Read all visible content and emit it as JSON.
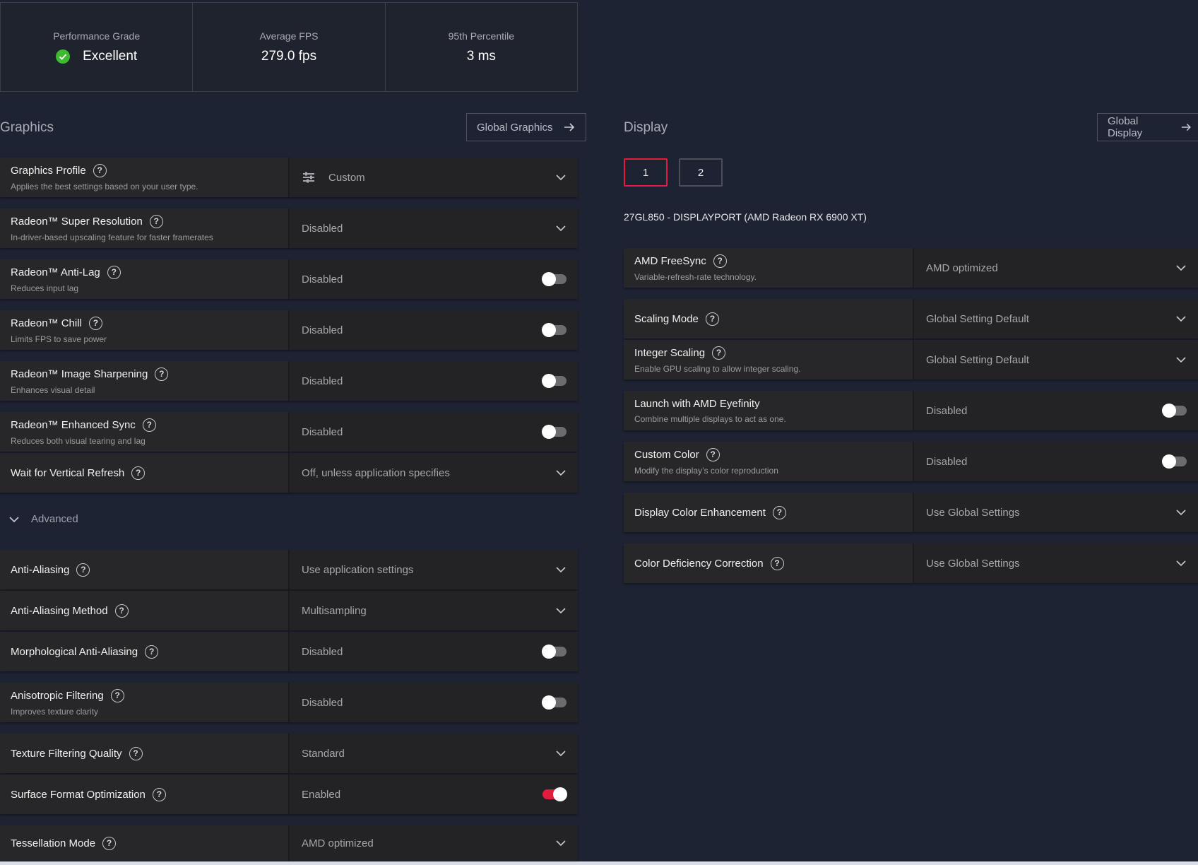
{
  "stats": [
    {
      "label": "Performance Grade",
      "value": "Excellent"
    },
    {
      "label": "Average FPS",
      "value": "279.0 fps"
    },
    {
      "label": "95th Percentile",
      "value": "3 ms"
    }
  ],
  "graphics": {
    "title": "Graphics",
    "global_button": "Global Graphics",
    "rows": [
      {
        "title": "Graphics Profile",
        "desc": "Applies the best settings based on your user type.",
        "value": "Custom",
        "control": "dropdown"
      },
      {
        "title": "Radeon™ Super Resolution",
        "desc": "In-driver-based upscaling feature for faster framerates",
        "value": "Disabled",
        "control": "dropdown"
      },
      {
        "title": "Radeon™ Anti-Lag",
        "desc": "Reduces input lag",
        "value": "Disabled",
        "control": "toggle"
      },
      {
        "title": "Radeon™ Chill",
        "desc": "Limits FPS to save power",
        "value": "Disabled",
        "control": "toggle"
      },
      {
        "title": "Radeon™ Image Sharpening",
        "desc": "Enhances visual detail",
        "value": "Disabled",
        "control": "toggle"
      },
      {
        "title": "Radeon™ Enhanced Sync",
        "desc": "Reduces both visual tearing and lag",
        "value": "Disabled",
        "control": "toggle"
      },
      {
        "title": "Wait for Vertical Refresh",
        "desc": "",
        "value": "Off, unless application specifies",
        "control": "dropdown"
      }
    ],
    "advanced_label": "Advanced",
    "advanced_rows": [
      {
        "title": "Anti-Aliasing",
        "desc": "",
        "value": "Use application settings",
        "control": "dropdown"
      },
      {
        "title": "Anti-Aliasing Method",
        "desc": "",
        "value": "Multisampling",
        "control": "dropdown"
      },
      {
        "title": "Morphological Anti-Aliasing",
        "desc": "",
        "value": "Disabled",
        "control": "toggle"
      },
      {
        "title": "Anisotropic Filtering",
        "desc": "Improves texture clarity",
        "value": "Disabled",
        "control": "toggle"
      },
      {
        "title": "Texture Filtering Quality",
        "desc": "",
        "value": "Standard",
        "control": "dropdown"
      },
      {
        "title": "Surface Format Optimization",
        "desc": "",
        "value": "Enabled",
        "control": "toggle-on"
      },
      {
        "title": "Tessellation Mode",
        "desc": "",
        "value": "AMD optimized",
        "control": "dropdown"
      }
    ]
  },
  "display": {
    "title": "Display",
    "global_button": "Global Display",
    "tabs": [
      "1",
      "2"
    ],
    "monitor": "27GL850 - DISPLAYPORT (AMD Radeon RX 6900 XT)",
    "rows": [
      {
        "title": "AMD FreeSync",
        "desc": "Variable-refresh-rate technology.",
        "value": "AMD optimized",
        "control": "dropdown"
      },
      {
        "title": "Scaling Mode",
        "desc": "",
        "value": "Global Setting Default",
        "control": "dropdown"
      },
      {
        "title": "Integer Scaling",
        "desc": "Enable GPU scaling to allow integer scaling.",
        "value": "Global Setting Default",
        "control": "dropdown"
      },
      {
        "title": "Launch with AMD Eyefinity",
        "desc": "Combine multiple displays to act as one.",
        "value": "Disabled",
        "control": "toggle"
      },
      {
        "title": "Custom Color",
        "desc": "Modify the display’s color reproduction",
        "value": "Disabled",
        "control": "toggle"
      },
      {
        "title": "Display Color Enhancement",
        "desc": "",
        "value": "Use Global Settings",
        "control": "dropdown"
      },
      {
        "title": "Color Deficiency Correction",
        "desc": "",
        "value": "Use Global Settings",
        "control": "dropdown"
      }
    ]
  },
  "colors": {
    "accent": "#e31b3d",
    "success": "#3cbb2f",
    "background": "#1e2333"
  }
}
